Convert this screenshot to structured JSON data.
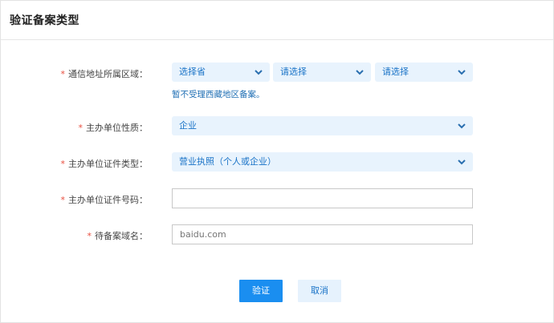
{
  "header": {
    "title": "验证备案类型"
  },
  "form": {
    "region": {
      "required_mark": "*",
      "label": "通信地址所属区域：",
      "province": "选择省",
      "city": "请选择",
      "district": "请选择",
      "note": "暂不受理西藏地区备案。"
    },
    "unit_nature": {
      "required_mark": "*",
      "label": "主办单位性质：",
      "value": "企业"
    },
    "cert_type": {
      "required_mark": "*",
      "label": "主办单位证件类型：",
      "value": "营业执照（个人或企业）"
    },
    "cert_number": {
      "required_mark": "*",
      "label": "主办单位证件号码：",
      "value": "",
      "placeholder": ""
    },
    "domain": {
      "required_mark": "*",
      "label": "待备案域名：",
      "placeholder": "baidu.com"
    }
  },
  "actions": {
    "confirm_label": "验证",
    "cancel_label": "取消"
  },
  "colors": {
    "accent": "#1a8ef0",
    "select_bg": "#e8f3fd",
    "required": "#e84c3d"
  },
  "icons": {
    "dropdown": "chevron-down-icon"
  }
}
